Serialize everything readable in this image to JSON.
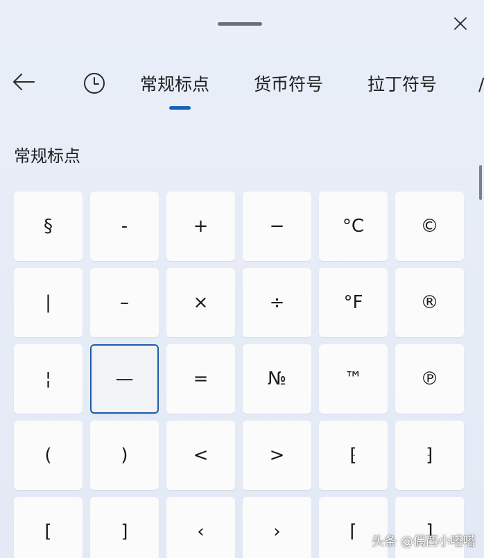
{
  "header": {
    "close_icon": "close-icon",
    "back_icon": "back-arrow-icon",
    "history_icon": "clock-icon"
  },
  "tabs": [
    {
      "label": "常规标点",
      "selected": true
    },
    {
      "label": "货币符号",
      "selected": false
    },
    {
      "label": "拉丁符号",
      "selected": false
    }
  ],
  "tab_overflow": "/",
  "section": {
    "title": "常规标点"
  },
  "symbols": [
    "§",
    "-",
    "+",
    "−",
    "°C",
    "©",
    "|",
    "–",
    "×",
    "÷",
    "°F",
    "®",
    "¦",
    "—",
    "=",
    "№",
    "™",
    "℗",
    "(",
    ")",
    "<",
    ">",
    "⁅",
    "⁆",
    "[",
    "]",
    "‹",
    "›",
    "⌈",
    "⌉"
  ],
  "selected_symbol": "—",
  "watermark": "头条 @偶西小嗒嗒",
  "colors": {
    "accent": "#1762b4",
    "selected_border": "#1d5ca6",
    "background": "#e7edf7",
    "key": "#fbfbfc"
  }
}
